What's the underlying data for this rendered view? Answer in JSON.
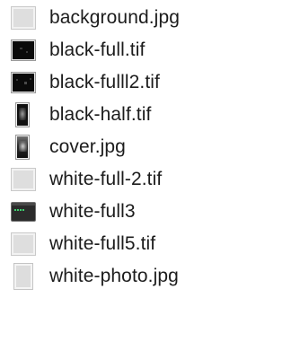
{
  "files": [
    {
      "name": "background.jpg",
      "thumbnail": "light-image-thumbnail-icon"
    },
    {
      "name": "black-full.tif",
      "thumbnail": "dark-image-thumbnail-icon"
    },
    {
      "name": "black-fulll2.tif",
      "thumbnail": "dark-image-thumbnail-icon"
    },
    {
      "name": "black-half.tif",
      "thumbnail": "dark-portrait-thumbnail-icon"
    },
    {
      "name": "cover.jpg",
      "thumbnail": "cover-portrait-thumbnail-icon"
    },
    {
      "name": "white-full-2.tif",
      "thumbnail": "light-image-thumbnail-icon"
    },
    {
      "name": "white-full3",
      "thumbnail": "terminal-thumbnail-icon"
    },
    {
      "name": "white-full5.tif",
      "thumbnail": "light-image-thumbnail-icon"
    },
    {
      "name": "white-photo.jpg",
      "thumbnail": "light-portrait-thumbnail-icon"
    }
  ]
}
